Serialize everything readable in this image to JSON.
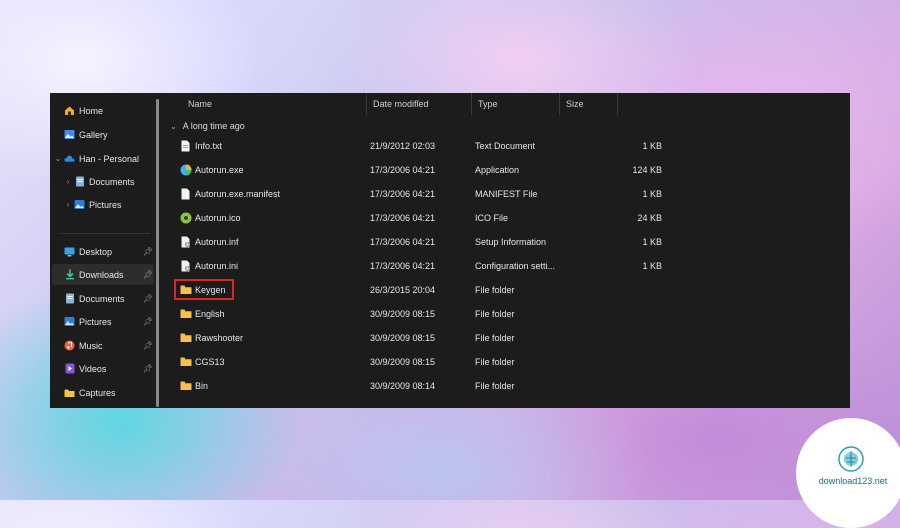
{
  "sidebar": {
    "items": [
      {
        "label": "Home",
        "icon": "home-icon"
      },
      {
        "label": "Gallery",
        "icon": "gallery-icon"
      },
      {
        "label": "Han - Personal",
        "icon": "cloud-icon"
      },
      {
        "label": "Documents",
        "icon": "document-icon"
      },
      {
        "label": "Pictures",
        "icon": "picture-icon"
      },
      {
        "label": "Desktop",
        "icon": "desktop-icon"
      },
      {
        "label": "Downloads",
        "icon": "download-icon"
      },
      {
        "label": "Documents",
        "icon": "document-icon"
      },
      {
        "label": "Pictures",
        "icon": "picture-icon"
      },
      {
        "label": "Music",
        "icon": "music-icon"
      },
      {
        "label": "Videos",
        "icon": "video-icon"
      },
      {
        "label": "Captures",
        "icon": "folder-icon"
      }
    ],
    "selected": "Downloads"
  },
  "columns": {
    "name": "Name",
    "date": "Date modified",
    "type": "Type",
    "size": "Size"
  },
  "group": {
    "label": "A long time ago"
  },
  "files": [
    {
      "name": "Info.txt",
      "date": "21/9/2012 02:03",
      "type": "Text Document",
      "size": "1 KB",
      "icon": "text-file-icon"
    },
    {
      "name": "Autorun.exe",
      "date": "17/3/2006 04:21",
      "type": "Application",
      "size": "124 KB",
      "icon": "application-icon"
    },
    {
      "name": "Autorun.exe.manifest",
      "date": "17/3/2006 04:21",
      "type": "MANIFEST File",
      "size": "1 KB",
      "icon": "file-icon"
    },
    {
      "name": "Autorun.ico",
      "date": "17/3/2006 04:21",
      "type": "ICO File",
      "size": "24 KB",
      "icon": "ico-file-icon"
    },
    {
      "name": "Autorun.inf",
      "date": "17/3/2006 04:21",
      "type": "Setup Information",
      "size": "1 KB",
      "icon": "settings-file-icon"
    },
    {
      "name": "Autorun.ini",
      "date": "17/3/2006 04:21",
      "type": "Configuration setti...",
      "size": "1 KB",
      "icon": "settings-file-icon"
    },
    {
      "name": "Keygen",
      "date": "26/3/2015 20:04",
      "type": "File folder",
      "size": "",
      "icon": "folder-icon"
    },
    {
      "name": "English",
      "date": "30/9/2009 08:15",
      "type": "File folder",
      "size": "",
      "icon": "folder-icon"
    },
    {
      "name": "Rawshooter",
      "date": "30/9/2009 08:15",
      "type": "File folder",
      "size": "",
      "icon": "folder-icon"
    },
    {
      "name": "CGS13",
      "date": "30/9/2009 08:15",
      "type": "File folder",
      "size": "",
      "icon": "folder-icon"
    },
    {
      "name": "Bin",
      "date": "30/9/2009 08:14",
      "type": "File folder",
      "size": "",
      "icon": "folder-icon"
    }
  ],
  "watermark": {
    "text": "download123.net"
  },
  "colors": {
    "window_bg": "#1c1c1c",
    "folder": "#f2c14e",
    "highlight": "#e02424",
    "accent": "#4aa8ff"
  }
}
